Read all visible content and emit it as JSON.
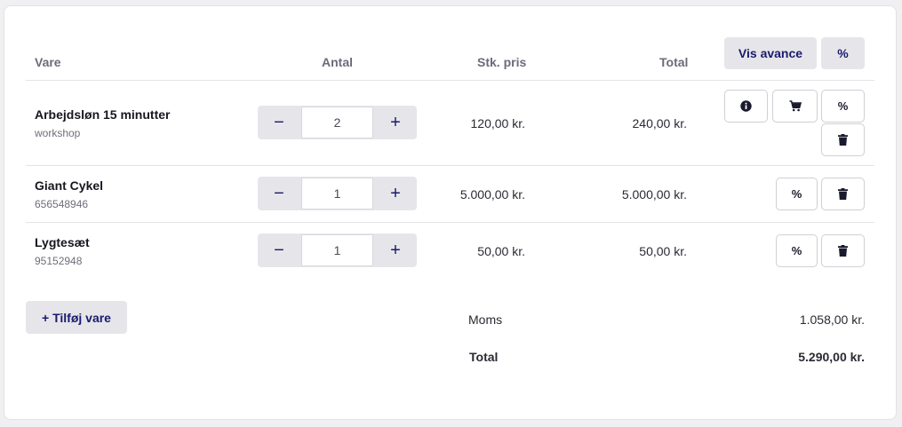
{
  "table": {
    "headers": {
      "item": "Vare",
      "qty": "Antal",
      "unit_price": "Stk. pris",
      "total": "Total"
    },
    "vis_avance_label": "Vis avance",
    "percent_label": "%"
  },
  "rows": [
    {
      "name": "Arbejdsløn 15 minutter",
      "sub": "workshop",
      "qty": "2",
      "unit_price": "120,00 kr.",
      "total": "240,00 kr.",
      "actions": [
        "info-icon",
        "cart-icon",
        "%",
        "trash-icon"
      ]
    },
    {
      "name": "Giant Cykel",
      "sub": "656548946",
      "qty": "1",
      "unit_price": "5.000,00 kr.",
      "total": "5.000,00 kr.",
      "actions": [
        "%",
        "trash-icon"
      ]
    },
    {
      "name": "Lygtesæt",
      "sub": "95152948",
      "qty": "1",
      "unit_price": "50,00 kr.",
      "total": "50,00 kr.",
      "actions": [
        "%",
        "trash-icon"
      ]
    }
  ],
  "stepper": {
    "minus": "−",
    "plus": "+"
  },
  "add_item_label": "+ Tilføj vare",
  "summary": {
    "vat_label": "Moms",
    "vat_value": "1.058,00 kr.",
    "total_label": "Total",
    "total_value": "5.290,00 kr."
  },
  "colors": {
    "accent": "#1a1a6e",
    "button_bg": "#e6e6ea",
    "border": "#cfcfd6"
  }
}
